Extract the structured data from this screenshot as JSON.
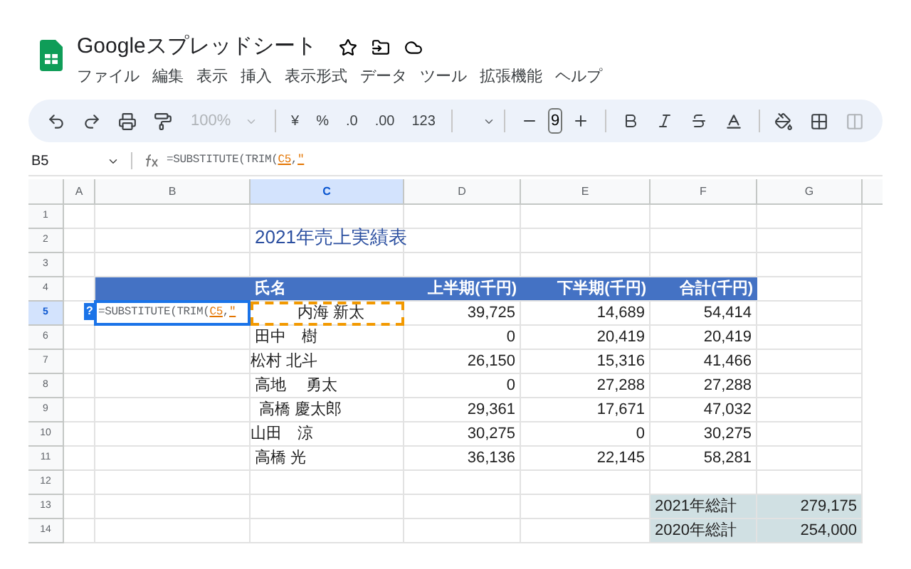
{
  "app": {
    "title": "Googleスプレッドシート",
    "menu": [
      "ファイル",
      "編集",
      "表示",
      "挿入",
      "表示形式",
      "データ",
      "ツール",
      "拡張機能",
      "ヘルプ"
    ]
  },
  "toolbar": {
    "zoom": "100%",
    "currency": "¥",
    "percent": "%",
    "decrease_decimal": ".0",
    "increase_decimal": ".00",
    "number_format": "123",
    "font_size": "9"
  },
  "formula_bar": {
    "cell_ref": "B5",
    "formula": [
      {
        "kind": "text",
        "text": "=SUBSTITUTE(TRIM("
      },
      {
        "kind": "ref",
        "text": "C5"
      },
      {
        "kind": "text",
        "text": ","
      },
      {
        "kind": "ref",
        "text": "\""
      }
    ]
  },
  "columns": [
    {
      "label": "A",
      "selected": false
    },
    {
      "label": "B",
      "selected": false
    },
    {
      "label": "C",
      "selected": true
    },
    {
      "label": "D",
      "selected": false
    },
    {
      "label": "E",
      "selected": false
    },
    {
      "label": "F",
      "selected": false
    },
    {
      "label": "G",
      "selected": false
    }
  ],
  "rows": [
    {
      "label": "1",
      "selected": false
    },
    {
      "label": "2",
      "selected": false
    },
    {
      "label": "3",
      "selected": false
    },
    {
      "label": "4",
      "selected": false
    },
    {
      "label": "5",
      "selected": true
    },
    {
      "label": "6",
      "selected": false
    },
    {
      "label": "7",
      "selected": false
    },
    {
      "label": "8",
      "selected": false
    },
    {
      "label": "9",
      "selected": false
    },
    {
      "label": "10",
      "selected": false
    },
    {
      "label": "11",
      "selected": false
    },
    {
      "label": "12",
      "selected": false
    },
    {
      "label": "13",
      "selected": false
    },
    {
      "label": "14",
      "selected": false
    }
  ],
  "table": {
    "title": "2021年売上実績表",
    "headers": [
      "氏名",
      "上半期(千円)",
      "下半期(千円)",
      "合計(千円)"
    ],
    "rows": [
      {
        "name": "　　　内海 新太",
        "first_half": "39,725",
        "second_half": "14,689",
        "total": "54,414",
        "referenced": true
      },
      {
        "name": " 田中　樹",
        "first_half": "0",
        "second_half": "20,419",
        "total": "20,419",
        "referenced": false
      },
      {
        "name": "松村 北斗",
        "first_half": "26,150",
        "second_half": "15,316",
        "total": "41,466",
        "referenced": false
      },
      {
        "name": " 高地　 勇太",
        "first_half": "0",
        "second_half": "27,288",
        "total": "27,288",
        "referenced": false
      },
      {
        "name": "  高橋 慶太郎",
        "first_half": "29,361",
        "second_half": "17,671",
        "total": "47,032",
        "referenced": false
      },
      {
        "name": "山田　涼",
        "first_half": "30,275",
        "second_half": "0",
        "total": "30,275",
        "referenced": false
      },
      {
        "name": " 高橋 光",
        "first_half": "36,136",
        "second_half": "22,145",
        "total": "58,281",
        "referenced": false
      }
    ]
  },
  "totals": [
    {
      "label": "2021年総計",
      "value": "279,175"
    },
    {
      "label": "2020年総計",
      "value": "254,000"
    }
  ],
  "editing_cell": {
    "hint": "?",
    "formula": [
      {
        "kind": "text",
        "text": "=SUBSTITUTE(TRIM("
      },
      {
        "kind": "ref",
        "text": "C5"
      },
      {
        "kind": "text",
        "text": ","
      },
      {
        "kind": "ref",
        "text": "\""
      }
    ]
  }
}
